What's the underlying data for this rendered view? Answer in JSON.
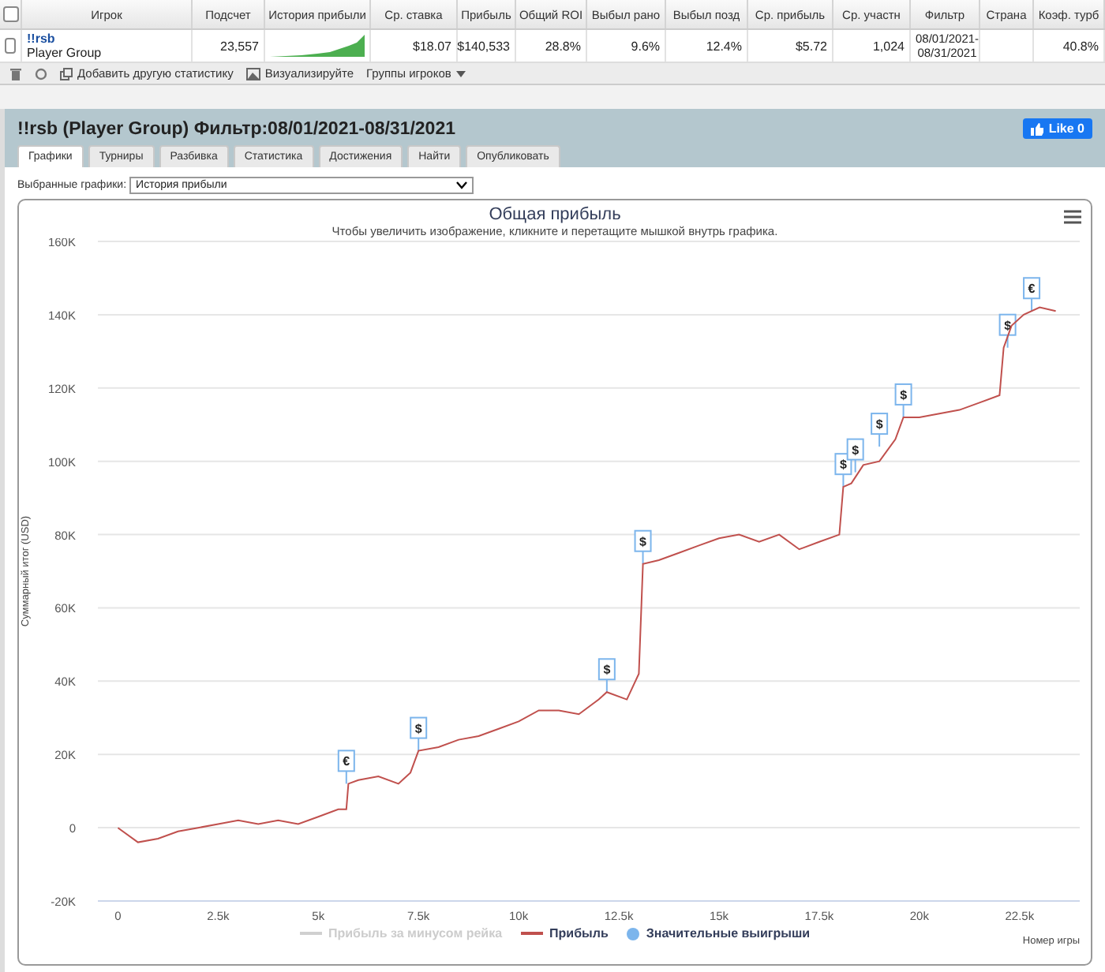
{
  "stats_table": {
    "select_all_checked": false,
    "columns": [
      "Игрок",
      "Подсчет",
      "История прибыли",
      "Ср. ставка",
      "Прибыль",
      "Общий ROI",
      "Выбыл рано",
      "Выбыл позд",
      "Ср. прибыль",
      "Ср. участн",
      "Фильтр",
      "Страна",
      "Коэф. турб"
    ],
    "rows": [
      {
        "checked": false,
        "player": "!!rsb",
        "group": "Player Group",
        "count": "23,557",
        "avg_stake": "$18.07",
        "profit": "$140,533",
        "roi": "28.8%",
        "early": "9.6%",
        "late": "12.4%",
        "avg_profit": "$5.72",
        "avg_entrants": "1,024",
        "filter": "08/01/2021-08/31/2021",
        "country": "",
        "turbo": "40.8%"
      }
    ]
  },
  "toolbar": {
    "items": [
      {
        "kind": "trash"
      },
      {
        "kind": "refresh"
      },
      {
        "kind": "add",
        "label": "Добавить другую статистику"
      },
      {
        "kind": "image",
        "label": "Визуализируйте"
      },
      {
        "kind": "dropdown",
        "label": "Группы игроков"
      }
    ]
  },
  "panel": {
    "title": "!!rsb (Player Group) Фильтр:08/01/2021-08/31/2021",
    "like": {
      "label": "Like 0"
    },
    "tabs": [
      {
        "label": "Графики",
        "selected": true
      },
      {
        "label": "Турниры",
        "selected": false
      },
      {
        "label": "Разбивка",
        "selected": false
      },
      {
        "label": "Статистика",
        "selected": false
      },
      {
        "label": "Достижения",
        "selected": false
      },
      {
        "label": "Найти",
        "selected": false
      },
      {
        "label": "Опубликовать",
        "selected": false
      }
    ],
    "chart_select": {
      "label": "Выбранные графики:",
      "value": "История прибыли"
    },
    "chart": {
      "subtitle": "Чтобы увеличить изображение, кликните и перетащите мышкой внутрь графика.",
      "legend": [
        {
          "kind": "line",
          "label": "Прибыль за минусом рейка",
          "disabled": true,
          "color": "#d0d0d0"
        },
        {
          "kind": "series",
          "disabled": false
        },
        {
          "kind": "dot",
          "label": "Значительные выигрыши",
          "disabled": false,
          "color": "#7cb5ec"
        }
      ],
      "chart_data": {
        "type": "line",
        "title": "Общая прибыль",
        "xlabel": "Номер игры",
        "ylabel": "Суммарный итог (USD)",
        "x": [
          0,
          500,
          1000,
          1500,
          2000,
          2500,
          3000,
          3500,
          4000,
          4500,
          5000,
          5500,
          5700,
          5750,
          6000,
          6500,
          7000,
          7300,
          7500,
          8000,
          8500,
          9000,
          9500,
          10000,
          10500,
          11000,
          11500,
          12000,
          12200,
          12700,
          13000,
          13100,
          13500,
          14000,
          14500,
          15000,
          15500,
          16000,
          16500,
          17000,
          17500,
          18000,
          18100,
          18300,
          18600,
          19000,
          19400,
          19600,
          20000,
          20500,
          21000,
          21500,
          22000,
          22100,
          22300,
          22600,
          23000,
          23400
        ],
        "series": [
          {
            "name": "Прибыль",
            "color": "#c0504d",
            "values": [
              0,
              -4000,
              -3000,
              -1000,
              0,
              1000,
              2000,
              1000,
              2000,
              1000,
              3000,
              5000,
              5000,
              12000,
              13000,
              14000,
              12000,
              15000,
              21000,
              22000,
              24000,
              25000,
              27000,
              29000,
              32000,
              32000,
              31000,
              35000,
              37000,
              35000,
              42000,
              72000,
              73000,
              75000,
              77000,
              79000,
              80000,
              78000,
              80000,
              76000,
              78000,
              80000,
              93000,
              94000,
              99000,
              100000,
              106000,
              112000,
              112000,
              113000,
              114000,
              116000,
              118000,
              131000,
              137000,
              140000,
              142000,
              141000
            ]
          }
        ],
        "grid": true,
        "xlim": [
          -500,
          24000
        ],
        "ylim": [
          -20000,
          160000
        ],
        "xticks": [
          0,
          {
            "value": 2500,
            "label": "2.5k"
          },
          {
            "value": 5000,
            "label": "5k"
          },
          {
            "value": 7500,
            "label": "7.5k"
          },
          {
            "value": 10000,
            "label": "10k"
          },
          {
            "value": 12500,
            "label": "12.5k"
          },
          {
            "value": 15000,
            "label": "15k"
          },
          {
            "value": 17500,
            "label": "17.5k"
          },
          {
            "value": 20000,
            "label": "20k"
          },
          {
            "value": 22500,
            "label": "22.5k"
          }
        ],
        "yticks": [
          {
            "value": -20000,
            "label": "-20K"
          },
          0,
          {
            "value": 20000,
            "label": "20K"
          },
          {
            "value": 40000,
            "label": "40K"
          },
          {
            "value": 60000,
            "label": "60K"
          },
          {
            "value": 80000,
            "label": "80K"
          },
          {
            "value": 100000,
            "label": "100K"
          },
          {
            "value": 120000,
            "label": "120K"
          },
          {
            "value": 140000,
            "label": "140K"
          },
          {
            "value": 160000,
            "label": "160K"
          }
        ],
        "annotations": [
          {
            "x": 5700,
            "y": 12000,
            "text": "€"
          },
          {
            "x": 7500,
            "y": 21000,
            "text": "$"
          },
          {
            "x": 12200,
            "y": 37000,
            "text": "$"
          },
          {
            "x": 13100,
            "y": 72000,
            "text": "$"
          },
          {
            "x": 18100,
            "y": 93000,
            "text": "$"
          },
          {
            "x": 18400,
            "y": 97000,
            "text": "$"
          },
          {
            "x": 19000,
            "y": 104000,
            "text": "$"
          },
          {
            "x": 19600,
            "y": 112000,
            "text": "$"
          },
          {
            "x": 22200,
            "y": 131000,
            "text": "$"
          },
          {
            "x": 22800,
            "y": 141000,
            "text": "€"
          }
        ]
      }
    }
  }
}
